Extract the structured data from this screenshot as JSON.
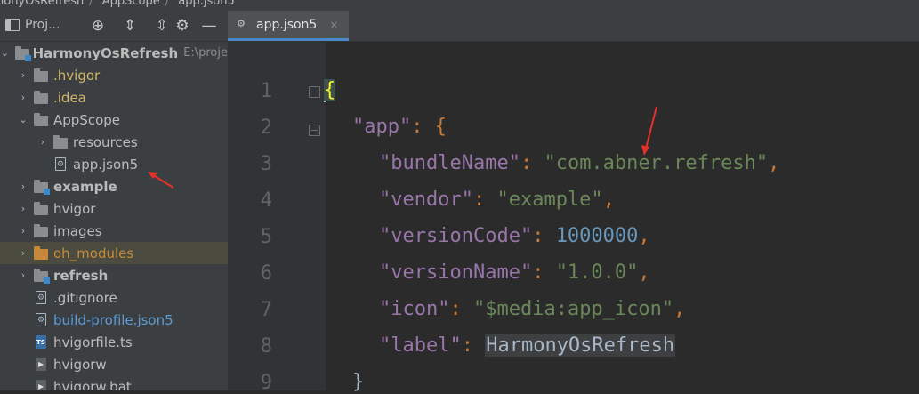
{
  "breadcrumbs": [
    "nonyOsRefresh",
    "AppScope",
    "app.json5"
  ],
  "project_panel": {
    "title": "Proj...",
    "toolbar_icons": [
      "target-icon",
      "expand-all-icon",
      "collapse-all-icon",
      "gear-icon",
      "minimize-icon"
    ]
  },
  "editor_tab": {
    "label": "app.json5",
    "close": "×"
  },
  "tree": [
    {
      "label": "HarmonyOsRefresh",
      "extra": "E:\\proje",
      "arrow": "⌄",
      "icon": "folder-module",
      "style": "bold",
      "indent": 0
    },
    {
      "label": ".hvigor",
      "arrow": "›",
      "icon": "folder",
      "style": "dim",
      "indent": 1
    },
    {
      "label": ".idea",
      "arrow": "›",
      "icon": "folder",
      "style": "dim",
      "indent": 1
    },
    {
      "label": "AppScope",
      "arrow": "⌄",
      "icon": "folder",
      "style": "normal",
      "indent": 1
    },
    {
      "label": "resources",
      "arrow": "›",
      "icon": "folder",
      "style": "normal",
      "indent": 2
    },
    {
      "label": "app.json5",
      "arrow": "",
      "icon": "file-gear",
      "style": "normal",
      "indent": 2
    },
    {
      "label": "example",
      "arrow": "›",
      "icon": "folder-module",
      "style": "bold",
      "indent": 1
    },
    {
      "label": "hvigor",
      "arrow": "›",
      "icon": "folder",
      "style": "normal",
      "indent": 1
    },
    {
      "label": "images",
      "arrow": "›",
      "icon": "folder",
      "style": "normal",
      "indent": 1
    },
    {
      "label": "oh_modules",
      "arrow": "›",
      "icon": "folder-orange",
      "style": "orange",
      "indent": 1
    },
    {
      "label": "refresh",
      "arrow": "›",
      "icon": "folder-module",
      "style": "bold",
      "indent": 1
    },
    {
      "label": ".gitignore",
      "arrow": "",
      "icon": "file-gear",
      "style": "normal",
      "indent": 1
    },
    {
      "label": "build-profile.json5",
      "arrow": "",
      "icon": "file-gear",
      "style": "blue",
      "indent": 1
    },
    {
      "label": "hvigorfile.ts",
      "arrow": "",
      "icon": "file-ts",
      "style": "normal",
      "indent": 1
    },
    {
      "label": "hvigorw",
      "arrow": "",
      "icon": "file-term",
      "style": "normal",
      "indent": 1
    },
    {
      "label": "hvigorw.bat",
      "arrow": "",
      "icon": "file-term",
      "style": "normal",
      "indent": 1
    }
  ],
  "line_numbers": [
    "1",
    "2",
    "3",
    "4",
    "5",
    "6",
    "7",
    "8",
    "9"
  ],
  "code": {
    "l1": "{",
    "l2_key": "\"app\"",
    "l2_rest": ": {",
    "l3_key": "\"bundleName\"",
    "l3_val": "\"com.abner.refresh\"",
    "l4_key": "\"vendor\"",
    "l4_val": "\"example\"",
    "l5_key": "\"versionCode\"",
    "l5_val": "1000000",
    "l6_key": "\"versionName\"",
    "l6_val": "\"1.0.0\"",
    "l7_key": "\"icon\"",
    "l7_val": "\"$media:app_icon\"",
    "l8_key": "\"label\"",
    "l8_val": "HarmonyOsRefresh",
    "l9": "}",
    "colon": ": ",
    "comma": ","
  },
  "colors": {
    "accent": "#4a88c7",
    "annotation": "#e8302a"
  }
}
